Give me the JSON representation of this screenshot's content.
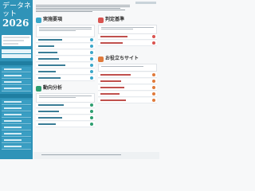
{
  "sidebar": {
    "logo_title": "データネット",
    "logo_year": "2026",
    "logo_sub": ""
  },
  "sections": {
    "exam": {
      "title": "実施要項",
      "color": "#3aa7c9"
    },
    "analysis": {
      "title": "判定基準",
      "color": "#d9534f"
    },
    "extra": {
      "title": "お役立ちサイト",
      "color": "#e07a3b"
    },
    "result": {
      "title": "動向分析",
      "color": "#2e9e6f"
    }
  },
  "colors": {
    "sidebar": "#2f93b8",
    "accent_blue": "#3aa7c9",
    "accent_red": "#d9534f",
    "accent_orange": "#e07a3b",
    "accent_green": "#2e9e6f"
  }
}
